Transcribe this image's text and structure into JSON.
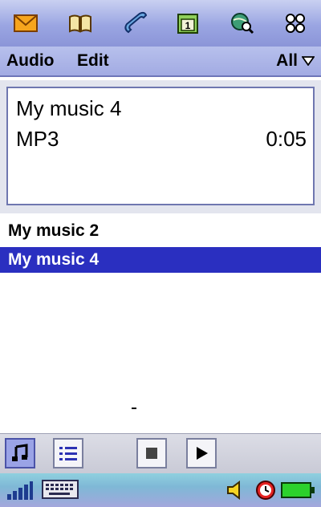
{
  "topbar": {
    "icons": [
      "mail-icon",
      "book-icon",
      "phone-icon",
      "calendar-icon",
      "globe-search-icon",
      "apps-grid-icon"
    ]
  },
  "menubar": {
    "audio": "Audio",
    "edit": "Edit",
    "filter": "All"
  },
  "now_playing": {
    "title": "My music 4",
    "format": "MP3",
    "time": "0:05"
  },
  "list": {
    "items": [
      "My music 2",
      "My music 4"
    ],
    "selected": "My music 4"
  },
  "controls": {
    "icons": [
      "music-note-icon",
      "list-icon",
      "stop-icon",
      "play-icon"
    ]
  },
  "statusbar": {
    "icons": [
      "signal-icon",
      "keyboard-icon",
      "volume-icon",
      "clock-icon",
      "battery-icon"
    ]
  },
  "colors": {
    "accent": "#2a2fc0"
  }
}
